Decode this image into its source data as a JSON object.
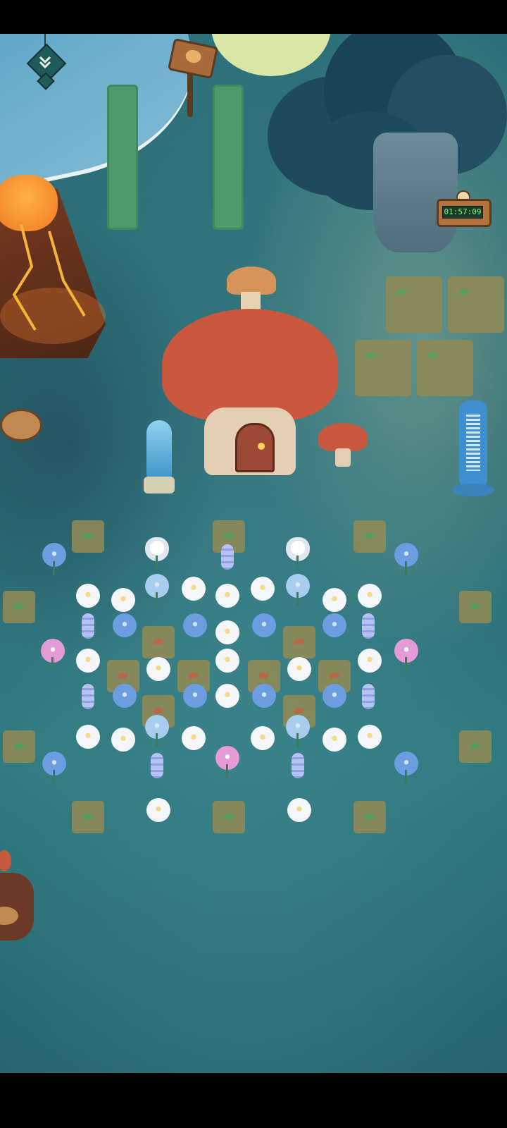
{
  "timer": {
    "value": "01:57:09"
  },
  "icons": {
    "menu": "double-chevron-down-icon",
    "signpost": "wooden-signpost-icon",
    "timer_search": "magnifier-icon"
  },
  "colors": {
    "ground": "#2b6b72",
    "mushroom_cap": "#c9583f",
    "timer_text": "#7dff7a",
    "timer_bg": "#1b3a2a",
    "lava": "#f2a23a"
  }
}
